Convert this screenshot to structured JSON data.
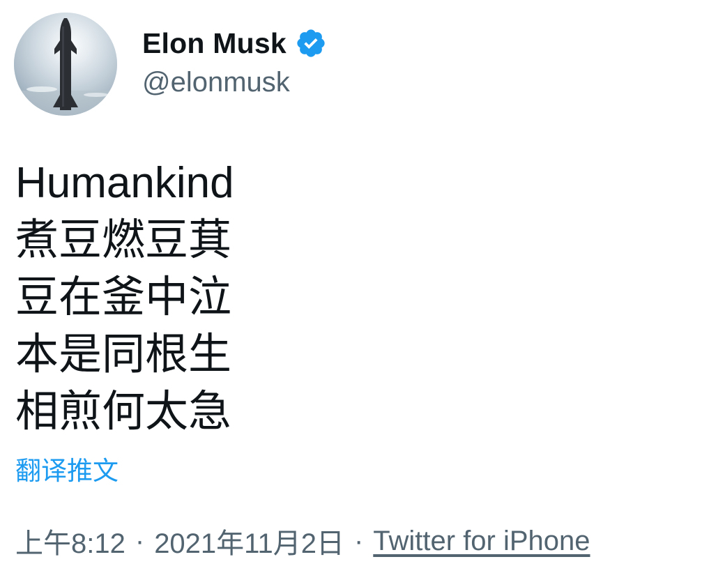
{
  "author": {
    "display_name": "Elon Musk",
    "handle": "@elonmusk",
    "verified_icon": "verified-badge-icon",
    "avatar_icon": "starship-avatar"
  },
  "tweet": {
    "lines": [
      "Humankind",
      "煮豆燃豆萁",
      "豆在釜中泣",
      "本是同根生",
      "相煎何太急"
    ],
    "translate_label": "翻译推文"
  },
  "meta": {
    "time": "上午8:12",
    "separator": "·",
    "date": "2021年11月2日",
    "source": "Twitter for iPhone"
  },
  "colors": {
    "text_primary": "#0f1419",
    "text_secondary": "#536471",
    "accent_blue": "#1d9bf0"
  }
}
